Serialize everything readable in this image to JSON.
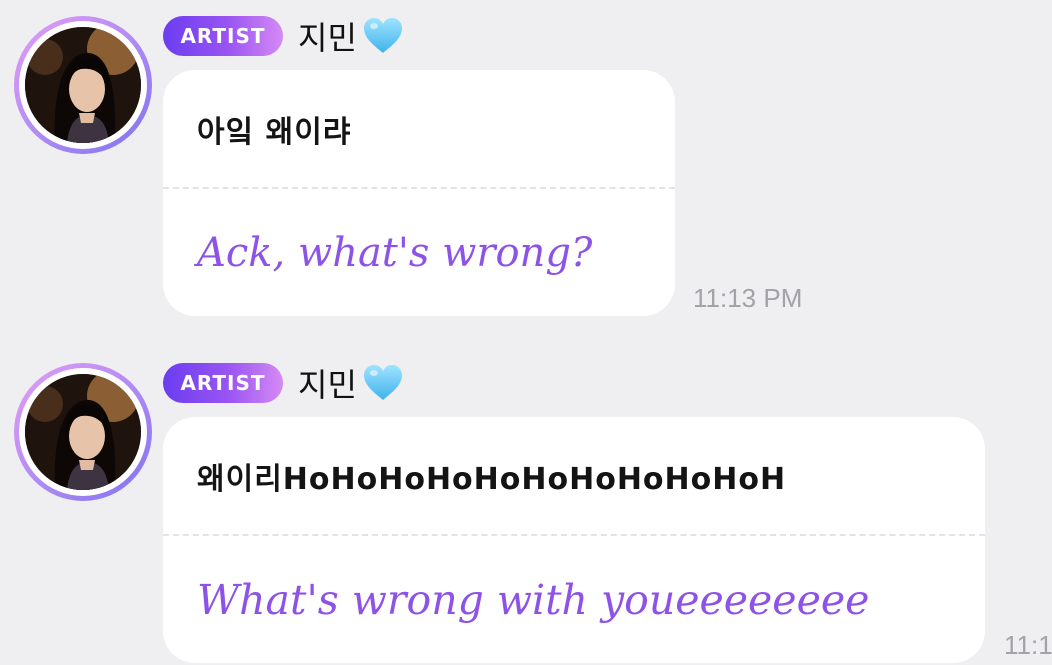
{
  "messages": [
    {
      "badge": "ARTIST",
      "sender": "지민",
      "heart_icon": "light-blue-heart-emoji",
      "original_text": "아잌 왜이랴",
      "translation_text": "Ack, what's wrong?",
      "timestamp": "11:13 PM"
    },
    {
      "badge": "ARTIST",
      "sender": "지민",
      "heart_icon": "light-blue-heart-emoji",
      "original_text": "왜이리HoHoHoHoHoHoHoHoHoHoH",
      "translation_text": "What's wrong with youeeeeeeee",
      "timestamp": "11:1"
    }
  ],
  "colors": {
    "background": "#efeff1",
    "bubble": "#ffffff",
    "translation": "#8d52e6",
    "badge_start": "#6a3df0",
    "badge_end": "#d58af4",
    "timestamp": "#a3a3a7"
  }
}
